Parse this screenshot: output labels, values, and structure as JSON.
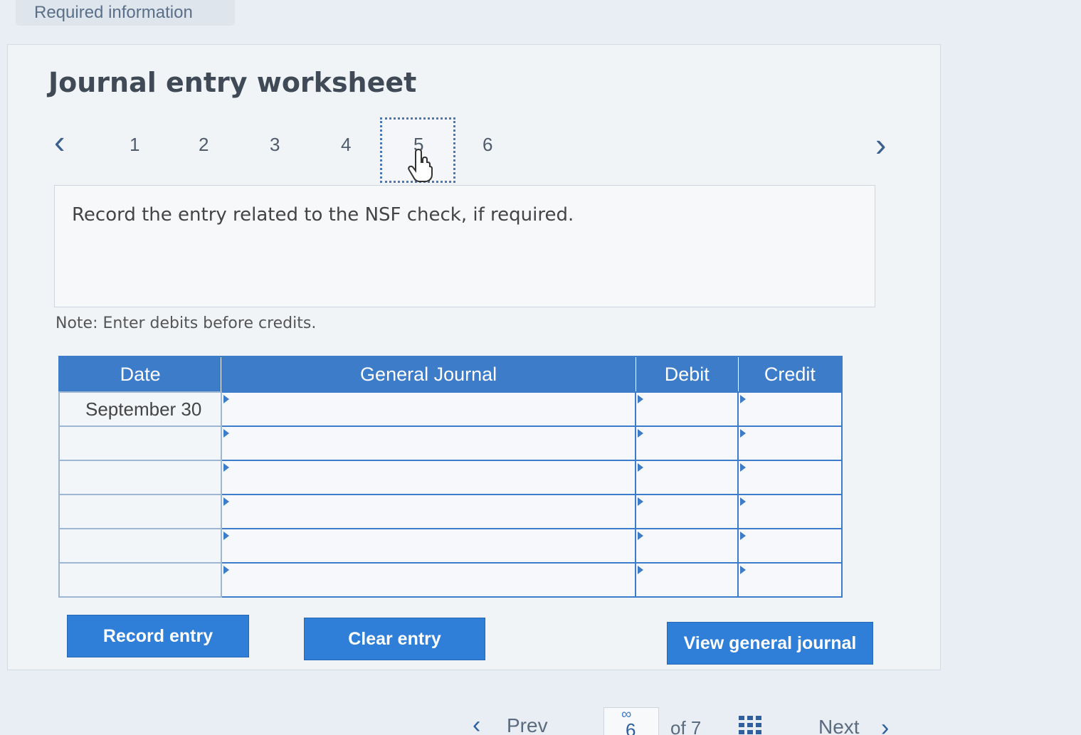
{
  "header": {
    "required_info": "Required information"
  },
  "worksheet": {
    "title": "Journal entry worksheet",
    "steps": [
      "1",
      "2",
      "3",
      "4",
      "5",
      "6"
    ],
    "selected_step": "5",
    "instruction": "Record the entry related to the NSF check, if required.",
    "note": "Note: Enter debits before credits."
  },
  "table": {
    "headers": [
      "Date",
      "General Journal",
      "Debit",
      "Credit"
    ],
    "rows": [
      {
        "date": "September 30",
        "account": "",
        "debit": "",
        "credit": ""
      },
      {
        "date": "",
        "account": "",
        "debit": "",
        "credit": ""
      },
      {
        "date": "",
        "account": "",
        "debit": "",
        "credit": ""
      },
      {
        "date": "",
        "account": "",
        "debit": "",
        "credit": ""
      },
      {
        "date": "",
        "account": "",
        "debit": "",
        "credit": ""
      },
      {
        "date": "",
        "account": "",
        "debit": "",
        "credit": ""
      }
    ]
  },
  "buttons": {
    "record": "Record entry",
    "clear": "Clear entry",
    "view_journal": "View general journal"
  },
  "pager": {
    "prev": "Prev",
    "current": "6",
    "of": "of 7",
    "next": "Next"
  },
  "colors": {
    "accent": "#3d7cc9",
    "button": "#2f7ed8"
  }
}
